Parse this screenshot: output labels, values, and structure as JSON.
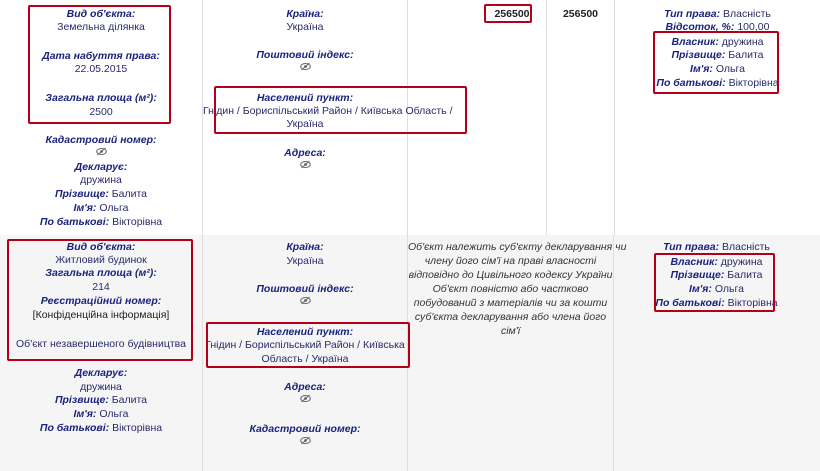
{
  "row1": {
    "object": {
      "type_label": "Вид об'єкта:",
      "type_value": "Земельна ділянка",
      "date_label": "Дата набуття права:",
      "date_value": "22.05.2015",
      "area_label": "Загальна площа (м²):",
      "area_value": "2500",
      "cadastre_label": "Кадастровий номер:"
    },
    "declarant": {
      "label": "Декларує:",
      "role": "дружина",
      "surname_label": "Прізвище:",
      "surname": "Балита",
      "name_label": "Ім'я:",
      "name": "Ольга",
      "patronymic_label": "По батькові:",
      "patronymic": "Вікторівна"
    },
    "location": {
      "country_label": "Країна:",
      "country": "Україна",
      "postal_label": "Поштовий індекс:",
      "settlement_label": "Населений пункт:",
      "settlement_line1": "Гнідин / Бориспільський Район / Київська Область /",
      "settlement_line2": "Україна",
      "address_label": "Адреса:"
    },
    "value_declared": "256500",
    "value_market": "256500",
    "rights": {
      "type_label": "Тип права:",
      "type_value": "Власність",
      "share_label": "Відсоток, %:",
      "share_value": "100,00",
      "owner_label": "Власник:",
      "owner_value": "дружина",
      "surname_label": "Прізвище:",
      "surname": "Балита",
      "name_label": "Ім'я:",
      "name": "Ольга",
      "patronymic_label": "По батькові:",
      "patronymic": "Вікторівна"
    }
  },
  "row2": {
    "object": {
      "type_label": "Вид об'єкта:",
      "type_value": "Житловий будинок",
      "area_label": "Загальна площа (м²):",
      "area_value": "214",
      "reg_label": "Реєстраційний номер:",
      "reg_value": "[Конфіденційна інформація]",
      "unfinished": "Об'єкт незавершеного будівництва"
    },
    "declarant": {
      "label": "Декларує:",
      "role": "дружина",
      "surname_label": "Прізвище:",
      "surname": "Балита",
      "name_label": "Ім'я:",
      "name": "Ольга",
      "patronymic_label": "По батькові:",
      "patronymic": "Вікторівна"
    },
    "location": {
      "country_label": "Країна:",
      "country": "Україна",
      "postal_label": "Поштовий індекс:",
      "settlement_label": "Населений пункт:",
      "settlement_line1": "Гнідин / Бориспільський Район / Київська",
      "settlement_line2": "Область / Україна",
      "address_label": "Адреса:",
      "cadastre_label": "Кадастровий номер:"
    },
    "note_lines": [
      "Об'єкт належить суб'єкту декларування чи",
      "члену його сім'ї на праві власності",
      "відповідно до Цивільного кодексу України",
      "Об'єкт повністю або частково",
      "побудований з матеріалів чи за кошти",
      "суб'єкта декларування або члена його",
      "сім'ї"
    ],
    "rights": {
      "type_label": "Тип права:",
      "type_value": "Власність",
      "owner_label": "Власник:",
      "owner_value": "дружина",
      "surname_label": "Прізвище:",
      "surname": "Балита",
      "name_label": "Ім'я:",
      "name": "Ольга",
      "patronymic_label": "По батькові:",
      "patronymic": "Вікторівна"
    }
  }
}
